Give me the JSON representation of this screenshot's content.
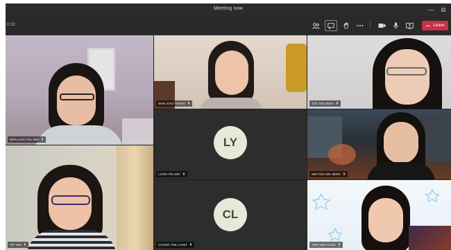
{
  "window": {
    "title": "Meeting now",
    "minimize": "—",
    "restore": "⧉"
  },
  "toolbar": {
    "timer": "0:32",
    "leave_label": "Leave"
  },
  "participants": [
    {
      "name": "WAN LIAN YOU WEI"
    },
    {
      "name": "WAN XIAO THENG"
    },
    {
      "name": "TZE YEE WINA"
    },
    {
      "name": "LIANG PEI WEI",
      "initials": "LY"
    },
    {
      "name": "SIM TOH XIN HENG"
    },
    {
      "name": "PEI WEI"
    },
    {
      "name": "CHONG YEE LIANG",
      "initials": "CL"
    },
    {
      "name": "YING WEI XUAN"
    }
  ],
  "colors": {
    "leave": "#c4314b",
    "tile_dark": "#2d2d2d",
    "avatar_bg": "#e8e8d8"
  }
}
